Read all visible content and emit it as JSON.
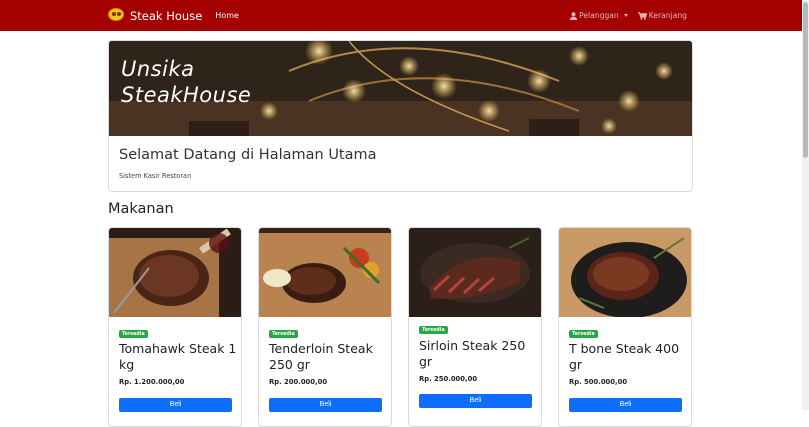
{
  "navbar": {
    "brand": "Steak House",
    "home": "Home",
    "customer": "Pelanggan",
    "cart": "Keranjang"
  },
  "hero": {
    "image_text": "Unsika\nSteakHouse",
    "title": "Selamat Datang di Halaman Utama",
    "subtitle": "Sistem Kasir Restoran"
  },
  "section": {
    "title": "Makanan"
  },
  "products": [
    {
      "badge": "Tersedia",
      "name": "Tomahawk Steak 1 kg",
      "price": "Rp. 1.200.000,00",
      "button": "Beli"
    },
    {
      "badge": "Tersedia",
      "name": "Tenderloin Steak 250 gr",
      "price": "Rp. 200.000,00",
      "button": "Beli"
    },
    {
      "badge": "Tersedia",
      "name": "Sirloin Steak 250 gr",
      "price": "Rp. 250.000,00",
      "button": "Beli"
    },
    {
      "badge": "Tersedia",
      "name": "T bone Steak 400 gr",
      "price": "Rp. 500.000,00",
      "button": "Beli"
    }
  ],
  "colors": {
    "navbar": "#a50000",
    "badge": "#28a745",
    "button": "#0d6efd"
  }
}
